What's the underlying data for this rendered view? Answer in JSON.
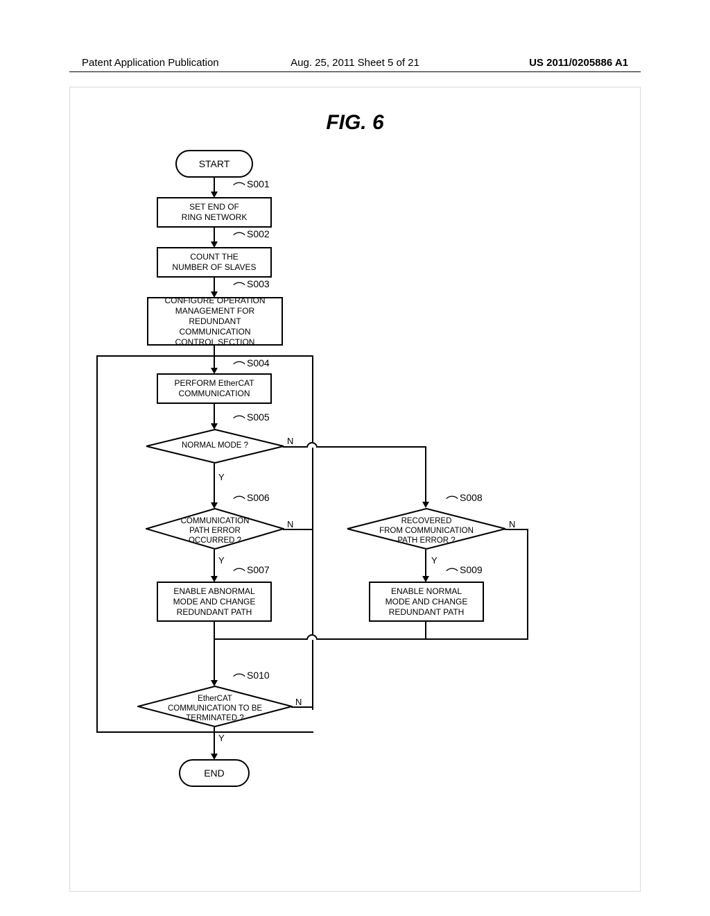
{
  "header": {
    "left": "Patent Application Publication",
    "center": "Aug. 25, 2011  Sheet 5 of 21",
    "right": "US 2011/0205886 A1"
  },
  "figure_title": "FIG. 6",
  "nodes": {
    "start": "START",
    "end": "END",
    "s001": "SET END OF\nRING NETWORK",
    "s002": "COUNT THE\nNUMBER OF SLAVES",
    "s003": "CONFIGURE OPERATION\nMANAGEMENT FOR\nREDUNDANT COMMUNICATION\nCONTROL SECTION",
    "s004": "PERFORM EtherCAT\nCOMMUNICATION",
    "s005": "NORMAL MODE ?",
    "s006": "COMMUNICATION\nPATH ERROR\nOCCURRED ?",
    "s007": "ENABLE ABNORMAL\nMODE AND CHANGE\nREDUNDANT PATH",
    "s008": "RECOVERED\nFROM COMMUNICATION\nPATH ERROR ?",
    "s009": "ENABLE NORMAL\nMODE AND CHANGE\nREDUNDANT PATH",
    "s010": "EtherCAT\nCOMMUNICATION TO BE\nTERMINATED ?"
  },
  "step_labels": {
    "s001": "S001",
    "s002": "S002",
    "s003": "S003",
    "s004": "S004",
    "s005": "S005",
    "s006": "S006",
    "s007": "S007",
    "s008": "S008",
    "s009": "S009",
    "s010": "S010"
  },
  "branches": {
    "yes": "Y",
    "no": "N"
  },
  "chart_data": {
    "type": "flowchart",
    "title": "FIG. 6",
    "nodes": [
      {
        "id": "start",
        "type": "terminator",
        "text": "START"
      },
      {
        "id": "S001",
        "type": "process",
        "text": "SET END OF RING NETWORK"
      },
      {
        "id": "S002",
        "type": "process",
        "text": "COUNT THE NUMBER OF SLAVES"
      },
      {
        "id": "S003",
        "type": "process",
        "text": "CONFIGURE OPERATION MANAGEMENT FOR REDUNDANT COMMUNICATION CONTROL SECTION"
      },
      {
        "id": "S004",
        "type": "process",
        "text": "PERFORM EtherCAT COMMUNICATION"
      },
      {
        "id": "S005",
        "type": "decision",
        "text": "NORMAL MODE ?"
      },
      {
        "id": "S006",
        "type": "decision",
        "text": "COMMUNICATION PATH ERROR OCCURRED ?"
      },
      {
        "id": "S007",
        "type": "process",
        "text": "ENABLE ABNORMAL MODE AND CHANGE REDUNDANT PATH"
      },
      {
        "id": "S008",
        "type": "decision",
        "text": "RECOVERED FROM COMMUNICATION PATH ERROR ?"
      },
      {
        "id": "S009",
        "type": "process",
        "text": "ENABLE NORMAL MODE AND CHANGE REDUNDANT PATH"
      },
      {
        "id": "S010",
        "type": "decision",
        "text": "EtherCAT COMMUNICATION TO BE TERMINATED ?"
      },
      {
        "id": "end",
        "type": "terminator",
        "text": "END"
      }
    ],
    "edges": [
      {
        "from": "start",
        "to": "S001"
      },
      {
        "from": "S001",
        "to": "S002"
      },
      {
        "from": "S002",
        "to": "S003"
      },
      {
        "from": "S003",
        "to": "S004"
      },
      {
        "from": "S004",
        "to": "S005"
      },
      {
        "from": "S005",
        "to": "S006",
        "label": "Y"
      },
      {
        "from": "S005",
        "to": "S008",
        "label": "N"
      },
      {
        "from": "S006",
        "to": "S007",
        "label": "Y"
      },
      {
        "from": "S006",
        "to": "S010",
        "label": "N"
      },
      {
        "from": "S007",
        "to": "S010"
      },
      {
        "from": "S008",
        "to": "S009",
        "label": "Y"
      },
      {
        "from": "S008",
        "to": "S010",
        "label": "N"
      },
      {
        "from": "S009",
        "to": "S010"
      },
      {
        "from": "S010",
        "to": "end",
        "label": "Y"
      },
      {
        "from": "S010",
        "to": "S004",
        "label": "N"
      }
    ]
  }
}
